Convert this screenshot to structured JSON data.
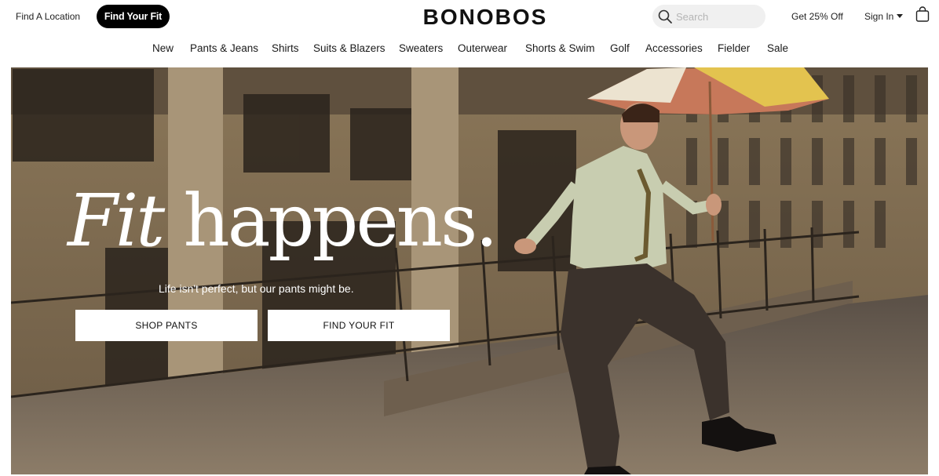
{
  "header": {
    "find_location": "Find A Location",
    "find_fit_button": "Find Your Fit",
    "logo": "BONOBOS",
    "search_placeholder": "Search",
    "promo": "Get 25% Off",
    "sign_in": "Sign In"
  },
  "nav": [
    "New",
    "Pants & Jeans",
    "Shirts",
    "Suits & Blazers",
    "Sweaters",
    "Outerwear",
    "Shorts & Swim",
    "Golf",
    "Accessories",
    "Fielder",
    "Sale"
  ],
  "hero": {
    "headline_italic": "Fit",
    "headline_rest": " happens.",
    "subline": "Life isn't perfect, but our pants might be.",
    "cta_primary": "SHOP PANTS",
    "cta_secondary": "FIND YOUR FIT"
  },
  "icons": {
    "search": "search-icon",
    "caret": "caret-down-icon",
    "bag": "shopping-bag-icon"
  }
}
